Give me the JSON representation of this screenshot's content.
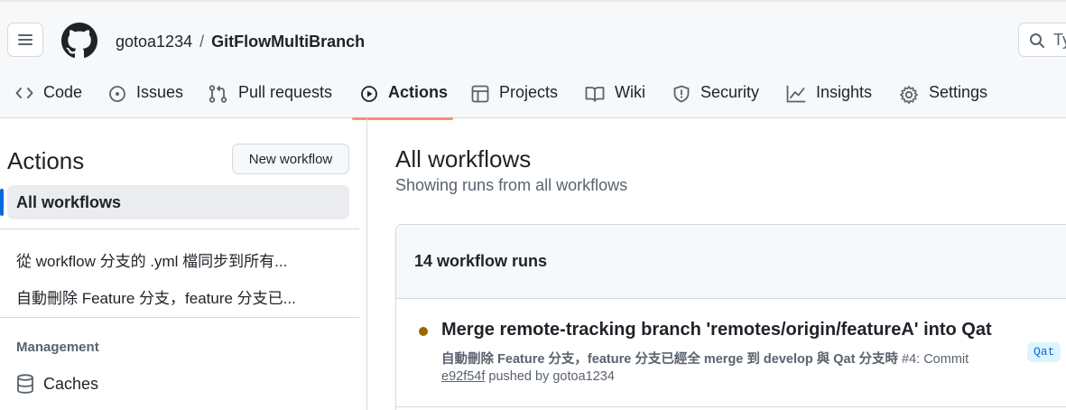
{
  "header": {
    "owner": "gotoa1234",
    "separator": "/",
    "repo": "GitFlowMultiBranch",
    "search_placeholder": "Ty"
  },
  "tabs": [
    {
      "label": "Code",
      "icon": "code-icon"
    },
    {
      "label": "Issues",
      "icon": "issue-opened-icon"
    },
    {
      "label": "Pull requests",
      "icon": "git-pull-request-icon"
    },
    {
      "label": "Actions",
      "icon": "play-icon",
      "active": true
    },
    {
      "label": "Projects",
      "icon": "table-icon"
    },
    {
      "label": "Wiki",
      "icon": "book-icon"
    },
    {
      "label": "Security",
      "icon": "shield-icon"
    },
    {
      "label": "Insights",
      "icon": "graph-icon"
    },
    {
      "label": "Settings",
      "icon": "gear-icon"
    }
  ],
  "sidebar": {
    "title": "Actions",
    "new_workflow": "New workflow",
    "all_workflows": "All workflows",
    "workflows": [
      "從 workflow 分支的 .yml 檔同步到所有...",
      "自動刪除 Feature 分支，feature 分支已..."
    ],
    "management_heading": "Management",
    "caches": "Caches"
  },
  "main": {
    "title": "All workflows",
    "subtitle": "Showing runs from all workflows",
    "runs_count": "14 workflow runs",
    "runs": [
      {
        "title": "Merge remote-tracking branch 'remotes/origin/featureA' into Qat",
        "workflow_name": "自動刪除 Feature 分支，feature 分支已經全 merge 到 develop 與 Qat 分支時",
        "run_info": " #4: Commit",
        "sha": "e92f54f",
        "pushed_by": " pushed by gotoa1234",
        "branch": "Qat",
        "status_color": "#9a6700"
      }
    ]
  },
  "colors": {
    "accent_underline": "#fd8c73",
    "selected_marker": "#0969da",
    "in_progress": "#9a6700"
  }
}
